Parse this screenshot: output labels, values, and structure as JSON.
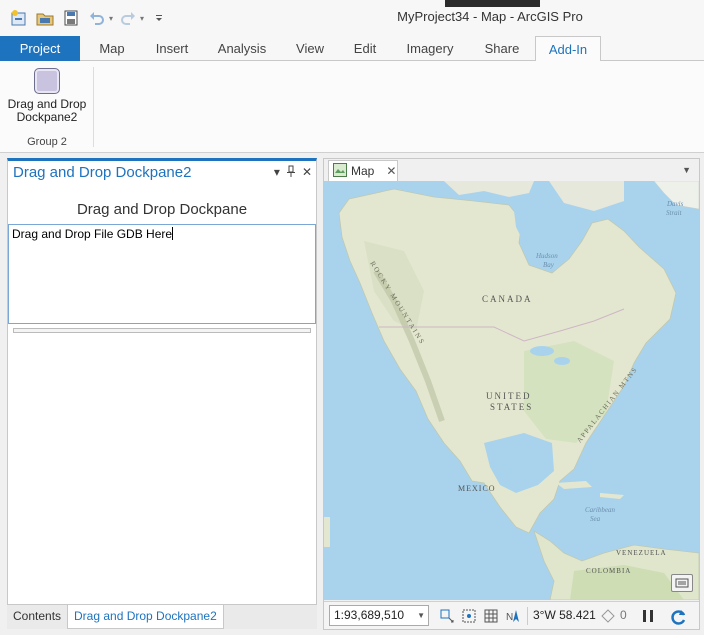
{
  "window": {
    "title": "MyProject34 - Map - ArcGIS Pro"
  },
  "quick_access": {
    "items": [
      {
        "icon": "new-project-icon"
      },
      {
        "icon": "open-project-icon"
      },
      {
        "icon": "save-project-icon"
      },
      {
        "icon": "undo-icon"
      },
      {
        "icon": "redo-icon"
      },
      {
        "icon": "customize-qat-icon"
      }
    ]
  },
  "ribbon": {
    "tabs": [
      "Project",
      "Map",
      "Insert",
      "Analysis",
      "View",
      "Edit",
      "Imagery",
      "Share",
      "Add-In"
    ],
    "active_tab": "Add-In",
    "group": {
      "label": "Group 2",
      "button_label_line1": "Drag and Drop",
      "button_label_line2": "Dockpane2"
    }
  },
  "dockpane": {
    "title": "Drag and Drop Dockpane2",
    "heading": "Drag and Drop Dockpane",
    "drop_text": "Drag and Drop File GDB Here"
  },
  "bottom_tabs": [
    "Contents",
    "Drag and Drop Dockpane2"
  ],
  "map_view": {
    "tab_label": "Map",
    "labels": {
      "canada": "CANADA",
      "united": "UNITED",
      "states": "STATES",
      "mexico": "MEXICO",
      "hudson": "Hudson",
      "bay": "Bay",
      "davis": "Davis",
      "strait": "Strait",
      "rocky": "ROCKY MOUNTAINS",
      "appalachian": "APPALACHIAN MTNS",
      "caribbean": "Caribbean",
      "sea": "Sea",
      "venezuela": "VENEZUELA",
      "colombia": "COLOMBIA"
    }
  },
  "status_bar": {
    "scale": "1:93,689,510",
    "coordinates": "3°W 58.421",
    "selected_count": "0"
  },
  "colors": {
    "accent": "#1e73be",
    "water": "#a9d3ec",
    "land": "#e4e7cf"
  }
}
